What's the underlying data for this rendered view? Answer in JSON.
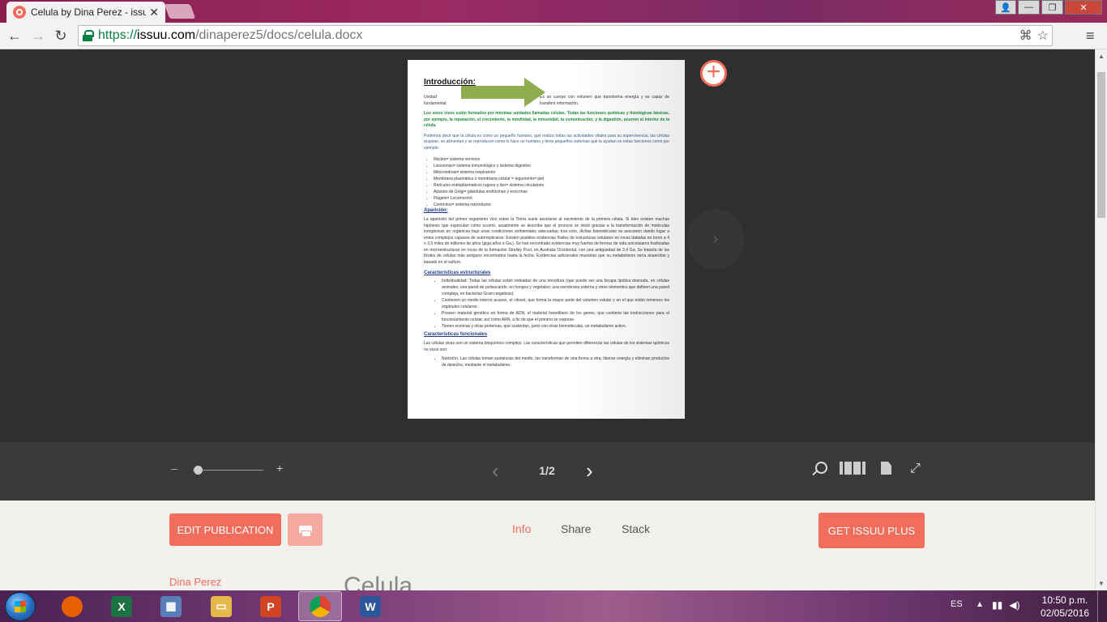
{
  "browser": {
    "tab_title": "Celula by Dina Perez - issu",
    "tab_close": "✕",
    "back": "←",
    "forward": "→",
    "reload": "↻",
    "url_https": "https://",
    "url_host": "issuu.com",
    "url_path": "/dinaperez5/docs/celula.docx",
    "translate_icon": "⌘",
    "star_icon": "☆",
    "menu_icon": "≡",
    "window_buttons": {
      "user": "👤",
      "minimize": "—",
      "maximize": "❐",
      "close": "✕"
    }
  },
  "document": {
    "heading": "Introducción:",
    "intro_left": "Unidad fundamental",
    "intro_right": "Es un cuerpo con volumen que transforma energía y es capaz de transferir información.",
    "para_green": "Los seres vivos están formados por mínimas unidades llamadas células. Todas las funciones químicas y fisiológicas básicas, por ejemplo, la reparación, el crecimiento, la movilidad, la inmunidad, la comunicación, y la digestión, ocurren al interior de la célula.",
    "para_blue": "Podemos decir que la célula es como un pequeño humano, que realiza todas las actividades vitales para su supervivencia, las células respiran, se alimentan y se reproducen como lo hace un humano y tiene pequeños sistemas que la ayudan en estas funciones como por ejemplo:",
    "organelles": [
      "Núcleo= sistema nervioso",
      "Lisosomas= sistema inmunológico y sistema digestivo",
      "Mitocondrias= sistema respiratorio",
      "Membrana plasmática o membrana celular = tegumento= piel",
      "Retículos endoplásmaticos rugoso y liso= sistema circulatorio",
      "Aparato de Golgi= glándulas endócrinas y exocrinas",
      "Flagelo= Locomoción",
      "Centriolos= sistema reproductor"
    ],
    "h_aparicion": "Aparición:",
    "para_aparicion": "La aparición del primer organismo vivo sobre la Tierra suele asociarse al nacimiento de la primera célula. Si bien existen muchas hipótesis que especulan cómo ocurrió, usualmente se describe que el proceso se inició gracias a la transformación de moléculas inorgánicas en orgánicas bajo unas condiciones ambientales adecuadas; tras esto, dichas biomoléculas se asociaron dando lugar a entes complejos capaces de autorreplicarse. Existen posibles evidencias fósiles de estructuras celulares en rocas datadas en torno a 4 o 3,5 miles de millones de años (giga-años o Ga.). Se han encontrado evidencias muy fuertes de formas de vida unicelulares fosilizadas en microestructuras en rocas de la formación Strelley Pool, en Australia Occidental, con una antigüedad de 3,4 Ga. Se trataría de los fósiles de células más antiguos encontrados hasta la fecha. Evidencias adicionales muestran que su metabolismo sería anaerobio y basado en el sulfuro.",
    "h_estructurales": "Características estructurales",
    "estructurales": [
      "Individualidad: Todas las células están rodeadas de una envoltura (que puede ser una bicapa lipídica desnuda, en células animales; una pared de polisacárido, en hongos y vegetales; una membrana externa y otros elementos que definen una pared compleja, en bacterias Gram negativas).",
      "Contienen un medio interno acuoso, el citosol, que forma la mayor parte del volumen celular y en el que están inmersos los orgánulos celulares.",
      "Poseen material genético en forma de ADN, el material hereditario de los genes, que contiene las instrucciones para el funcionamiento celular, así como ARN, a fin de que el primero se exprese.",
      "Tienen enzimas y otras proteínas, que sustentan, junto con otras biomoléculas, un metabolismo activo."
    ],
    "h_funcionales": "Características funcionales",
    "para_funcionales": "Las células vivas son un sistema bioquímico complejo. Las características que permiten diferenciar las células de los sistemas químicos no vivos son:",
    "funcionales": [
      "Nutrición. Las células toman sustancias del medio, las transforman de una forma a otra, liberan energía y eliminan productos de desecho, mediante el metabolismo."
    ]
  },
  "viewer": {
    "add_icon": "+",
    "next_icon": "›",
    "zoom_minus": "–",
    "zoom_plus": "+",
    "zoom_level": 0.05,
    "prev_arrow": "‹",
    "next_arrow": "›",
    "page_indicator": "1/2",
    "fullscreen_icon": "⤢"
  },
  "info": {
    "edit_label": "EDIT PUBLICATION",
    "tabs": [
      "Info",
      "Share",
      "Stack"
    ],
    "plus_label": "GET ISSUU PLUS",
    "author": "Dina Perez",
    "title": "Celula"
  },
  "taskbar": {
    "apps": [
      {
        "name": "firefox",
        "glyph": "",
        "color": "#e66000"
      },
      {
        "name": "excel",
        "glyph": "X",
        "color": "#1e7145"
      },
      {
        "name": "calculator",
        "glyph": "▦",
        "color": "#5a7fb8"
      },
      {
        "name": "explorer",
        "glyph": "▭",
        "color": "#e6b84a"
      },
      {
        "name": "powerpoint",
        "glyph": "P",
        "color": "#d04423"
      },
      {
        "name": "chrome",
        "glyph": "",
        "color": "#4285f4"
      },
      {
        "name": "word",
        "glyph": "W",
        "color": "#2b579a"
      }
    ],
    "lang": "ES",
    "tray_up": "▲",
    "time": "10:50 p.m.",
    "date": "02/05/2016"
  },
  "colors": {
    "accent": "#f26d5b",
    "viewer_bg": "#2f2f2f",
    "controls_bg": "#3a3a3a",
    "info_bg": "#f2f0ec"
  }
}
